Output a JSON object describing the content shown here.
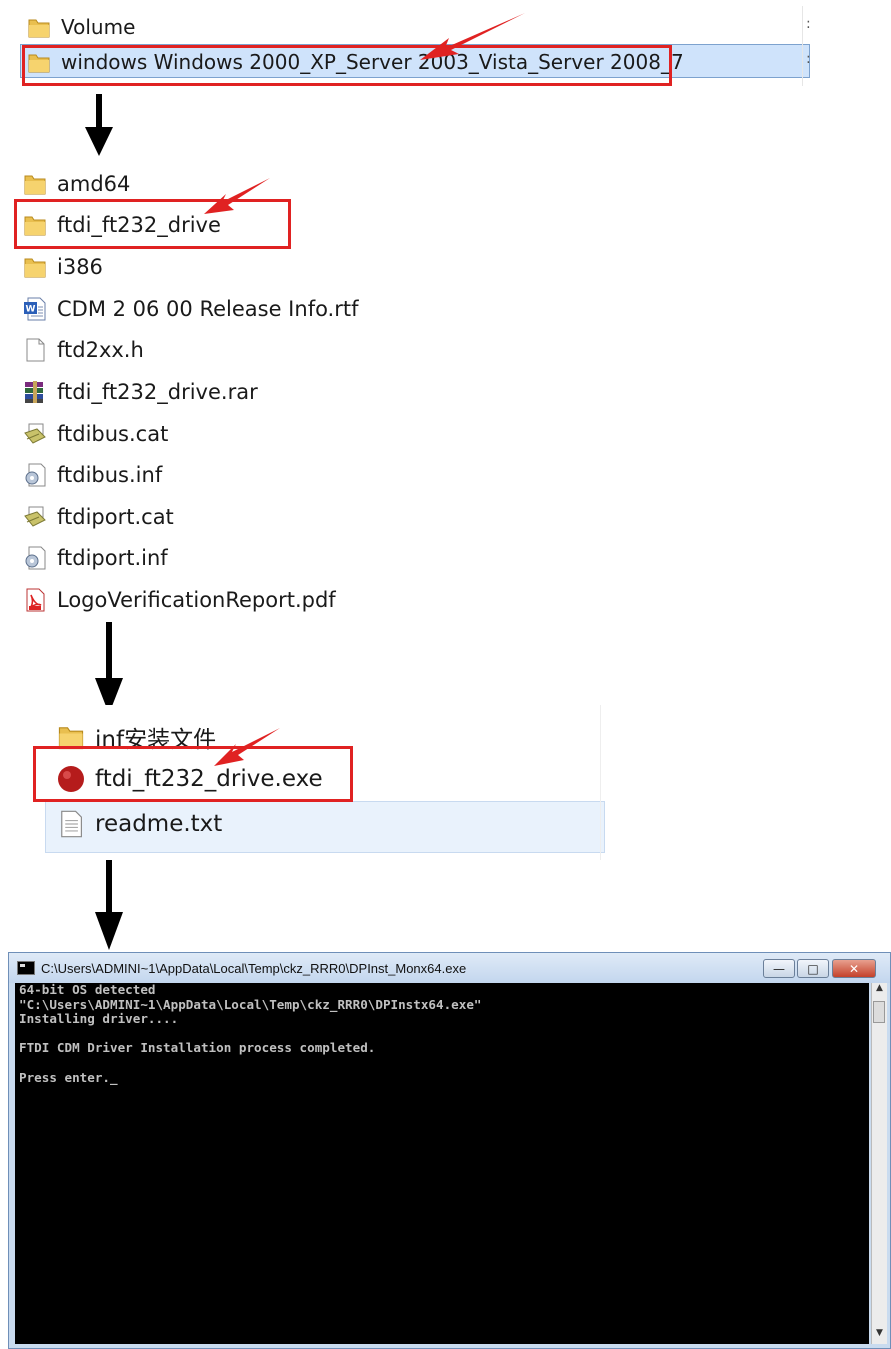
{
  "colors": {
    "highlight_box": "#e02222",
    "arrow_red": "#e02222",
    "arrow_black": "#000000",
    "selection": "#cfe3fb",
    "console_bg": "#000000"
  },
  "step1": {
    "items": [
      {
        "label": "Volume",
        "icon": "folder-icon"
      },
      {
        "label": "windows Windows 2000_XP_Server 2003_Vista_Server 2008_7",
        "icon": "folder-icon",
        "selected": true
      }
    ],
    "tick": ":"
  },
  "step2": {
    "items": [
      {
        "label": "amd64",
        "icon": "folder-icon"
      },
      {
        "label": "ftdi_ft232_drive",
        "icon": "folder-icon",
        "highlighted": true
      },
      {
        "label": "i386",
        "icon": "folder-icon"
      },
      {
        "label": "CDM 2 06 00 Release Info.rtf",
        "icon": "word-document-icon"
      },
      {
        "label": "ftd2xx.h",
        "icon": "blank-file-icon"
      },
      {
        "label": "ftdi_ft232_drive.rar",
        "icon": "winrar-archive-icon"
      },
      {
        "label": "ftdibus.cat",
        "icon": "security-catalog-icon"
      },
      {
        "label": "ftdibus.inf",
        "icon": "setup-information-icon"
      },
      {
        "label": "ftdiport.cat",
        "icon": "security-catalog-icon"
      },
      {
        "label": "ftdiport.inf",
        "icon": "setup-information-icon"
      },
      {
        "label": "LogoVerificationReport.pdf",
        "icon": "pdf-icon"
      }
    ]
  },
  "step3": {
    "items": [
      {
        "label": "inf安装文件",
        "icon": "folder-icon"
      },
      {
        "label": "ftdi_ft232_drive.exe",
        "icon": "red-circle-exe-icon",
        "highlighted": true
      },
      {
        "label": "readme.txt",
        "icon": "text-file-icon"
      }
    ]
  },
  "console": {
    "title": "C:\\Users\\ADMINI~1\\AppData\\Local\\Temp\\ckz_RRR0\\DPInst_Monx64.exe",
    "lines": [
      "64-bit OS detected",
      "\"C:\\Users\\ADMINI~1\\AppData\\Local\\Temp\\ckz_RRR0\\DPInstx64.exe\"",
      "Installing driver....",
      "",
      "FTDI CDM Driver Installation process completed.",
      "",
      "Press enter._"
    ],
    "buttons": {
      "minimize": "—",
      "maximize": "□",
      "close": "✕"
    }
  }
}
